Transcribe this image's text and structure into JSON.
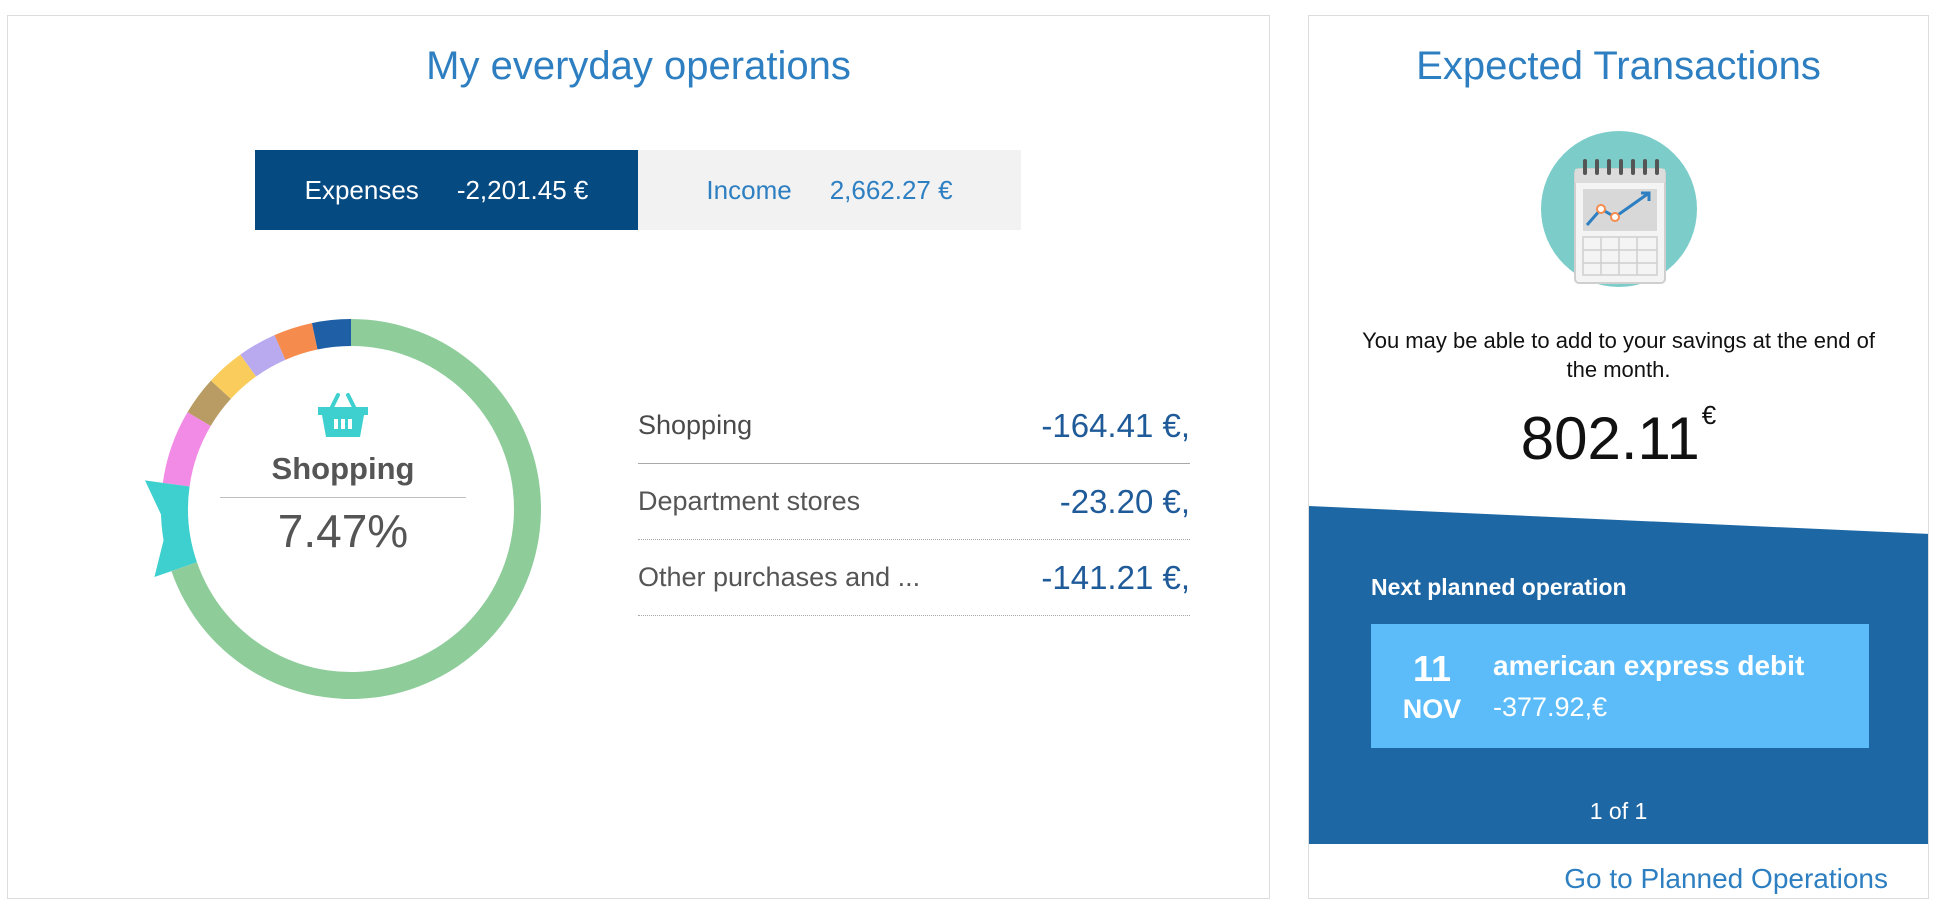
{
  "left_panel": {
    "title": "My everyday operations",
    "toggle": {
      "expenses": {
        "label": "Expenses",
        "amount": "-2,201.45 €"
      },
      "income": {
        "label": "Income",
        "amount": "2,662.27 €"
      }
    },
    "donut": {
      "center_label": "Shopping",
      "center_value": "7.47%",
      "center_icon": "shopping-basket-icon",
      "segments": [
        {
          "color": "#1f5fa6",
          "share": 0.033
        },
        {
          "color": "#f58b4c",
          "share": 0.033
        },
        {
          "color": "#b9aaf0",
          "share": 0.033
        },
        {
          "color": "#f9cc5c",
          "share": 0.033
        },
        {
          "color": "#b89c64",
          "share": 0.033
        },
        {
          "color": "#f18be6",
          "share": 0.063
        },
        {
          "color": "#3ecfcf",
          "share": 0.075
        },
        {
          "color": "#8ecc9a",
          "share": 0.697
        }
      ]
    },
    "categories": [
      {
        "name": "Shopping",
        "amount": "-164.41 €,"
      },
      {
        "name": "Department stores",
        "amount": "-23.20 €,"
      },
      {
        "name": "Other purchases and ...",
        "amount": "-141.21 €,"
      }
    ]
  },
  "right_panel": {
    "title": "Expected Transactions",
    "icon": "calendar-chart-icon",
    "savings_text": "You may be able to add to your savings at the end of the month.",
    "savings_amount": "802.11",
    "savings_currency": "€",
    "next_label": "Next planned operation",
    "operation": {
      "day": "11",
      "month": "NOV",
      "title": "american express debit",
      "amount": "-377.92,€"
    },
    "pager": "1 of 1",
    "link": "Go to Planned Operations",
    "colors": {
      "band": "#1e67a5",
      "card": "#5bbcf9"
    }
  }
}
